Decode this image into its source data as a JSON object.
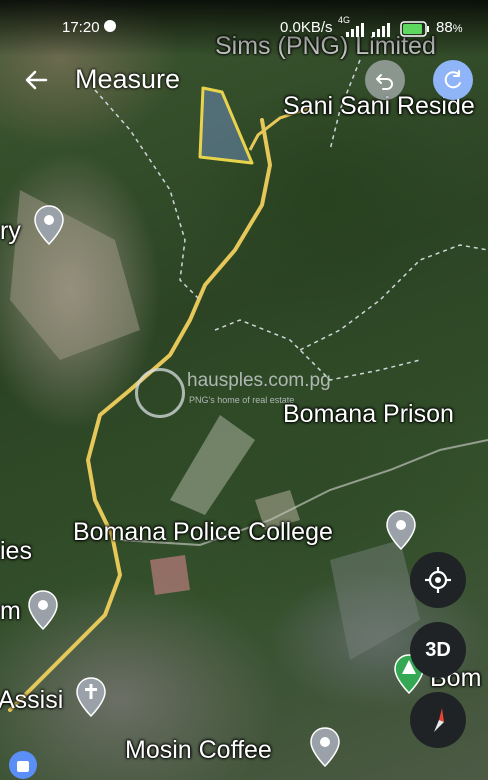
{
  "status_bar": {
    "time": "17:20",
    "network_speed": "0.0KB/s",
    "network_type": "4G",
    "battery": "88",
    "battery_unit": "%"
  },
  "header": {
    "title": "Measure",
    "back_icon": "arrow-left-icon",
    "undo_icon": "undo-icon",
    "redo_icon": "redo-icon"
  },
  "map_labels": {
    "sims": "Sims (PNG) Limited",
    "sani": "Sani Sani Reside",
    "ry": "ry",
    "bomana_prison": "Bomana Prison",
    "police_college": "Bomana Police College",
    "ies": "ies",
    "m": "m",
    "assisi": "Assisi",
    "mosin": "Mosin Coffee",
    "bom": "Bom"
  },
  "watermark": {
    "brand": "hausples.com.pg",
    "tagline": "PNG's home of real estate"
  },
  "controls": {
    "location_icon": "crosshair-icon",
    "threed_label": "3D",
    "compass_icon": "compass-icon"
  },
  "colors": {
    "polygon": "#e8d44a",
    "road": "#e6c75a",
    "accent_blue": "#5b8ff5",
    "pin_gray": "#9aa1a8",
    "pin_green": "#34a853"
  }
}
